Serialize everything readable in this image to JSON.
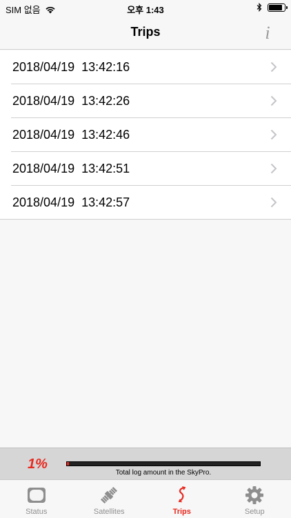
{
  "status_bar": {
    "carrier": "SIM 없음",
    "time": "오후 1:43"
  },
  "nav": {
    "title": "Trips",
    "info_label": "i"
  },
  "trips": [
    {
      "label": "2018/04/19  13:42:16"
    },
    {
      "label": "2018/04/19  13:42:26"
    },
    {
      "label": "2018/04/19  13:42:46"
    },
    {
      "label": "2018/04/19  13:42:51"
    },
    {
      "label": "2018/04/19  13:42:57"
    }
  ],
  "log": {
    "percent_label": "1%",
    "progress_fraction": 0.01,
    "caption": "Total log amount in the SkyPro."
  },
  "tabs": [
    {
      "label": "Status",
      "icon": "status-icon",
      "active": false
    },
    {
      "label": "Satellites",
      "icon": "satellite-icon",
      "active": false
    },
    {
      "label": "Trips",
      "icon": "trips-icon",
      "active": true
    },
    {
      "label": "Setup",
      "icon": "gear-icon",
      "active": false
    }
  ],
  "colors": {
    "accent": "#e8281e",
    "inactive_tab": "#8e8e8e",
    "background": "#f7f7f7"
  }
}
